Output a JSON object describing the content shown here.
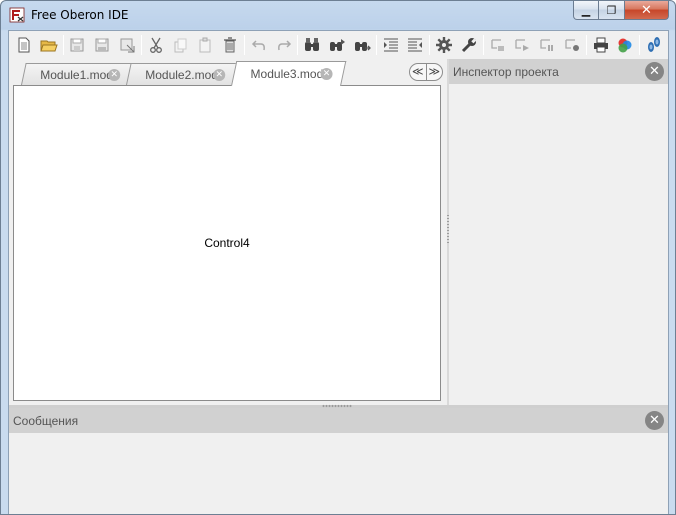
{
  "window": {
    "title": "Free Oberon IDE",
    "buttons": {
      "minimize": "▁",
      "maximize": "❐",
      "close": "✕"
    }
  },
  "toolbar": {
    "groups": [
      [
        "new-file-icon",
        "open-folder-icon"
      ],
      [
        "save-icon",
        "save-as-icon",
        "save-all-icon"
      ],
      [
        "cut-icon",
        "copy-icon",
        "paste-icon",
        "delete-icon"
      ],
      [
        "undo-icon",
        "redo-icon"
      ],
      [
        "find-icon",
        "find-next-icon",
        "replace-icon"
      ],
      [
        "indent-icon",
        "unindent-icon"
      ],
      [
        "settings-gear-icon",
        "tools-wrench-icon"
      ],
      [
        "run-icon",
        "run-step-icon",
        "run-to-cursor-icon",
        "breakpoint-icon"
      ],
      [
        "print-icon",
        "color-palette-icon"
      ],
      [
        "help-icon"
      ]
    ]
  },
  "tabs": [
    {
      "label": "Module1.mod",
      "active": false
    },
    {
      "label": "Module2.mod",
      "active": false
    },
    {
      "label": "Module3.mod",
      "active": true
    }
  ],
  "tab_scroll": {
    "left": "≪",
    "right": "≫"
  },
  "editor": {
    "content": "Control4"
  },
  "inspector": {
    "title": "Инспектор проекта"
  },
  "messages": {
    "title": "Сообщения"
  },
  "colors": {
    "titlebar": "#bcd1ea",
    "panel_header": "#d1d1d1",
    "close_red": "#c74629"
  }
}
